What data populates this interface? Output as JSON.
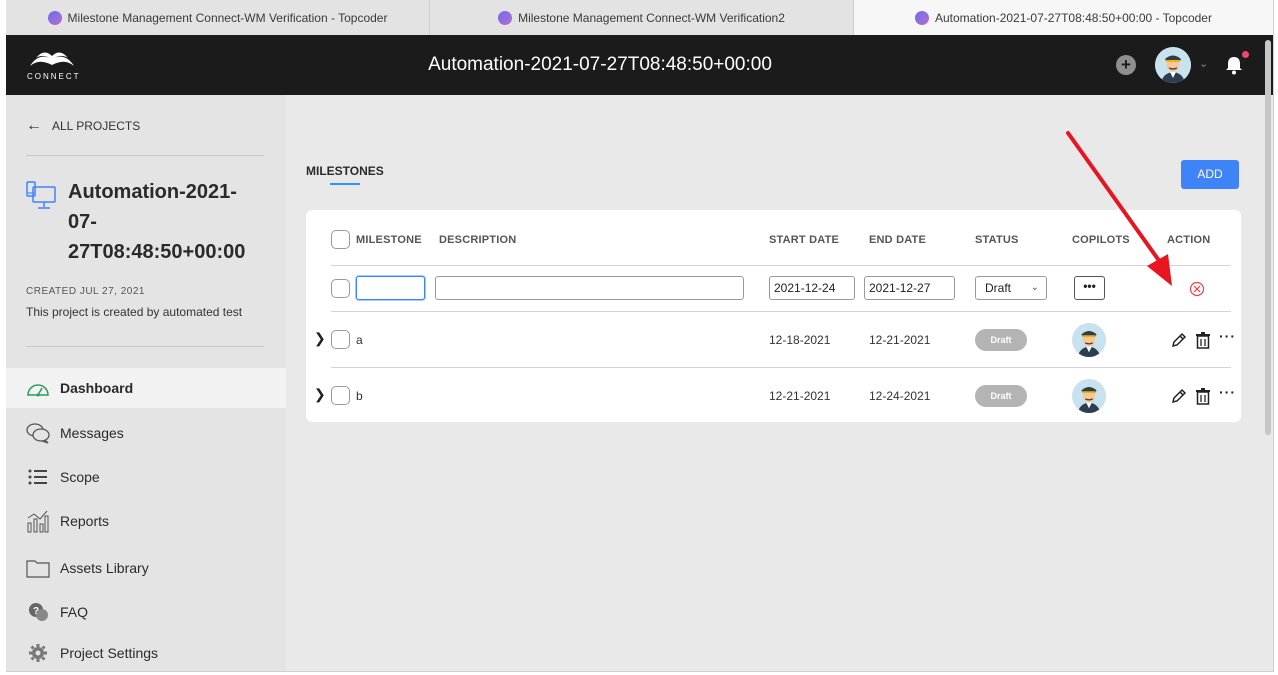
{
  "browser_tabs": [
    {
      "title": "Milestone Management Connect-WM Verification - Topcoder",
      "active": false
    },
    {
      "title": "Milestone Management Connect-WM Verification2",
      "active": false
    },
    {
      "title": "Automation-2021-07-27T08:48:50+00:00 - Topcoder",
      "active": true
    }
  ],
  "header": {
    "logo_text": "CONNECT",
    "project_title": "Automation-2021-07-27T08:48:50+00:00"
  },
  "sidebar": {
    "back_label": "ALL PROJECTS",
    "project_title_lines": [
      "Automation-2021-",
      "07-",
      "27T08:48:50+00:00"
    ],
    "created": "CREATED JUL 27, 2021",
    "description": "This project is created by automated test",
    "nav": [
      {
        "label": "Dashboard",
        "icon": "gauge-icon",
        "active": true
      },
      {
        "label": "Messages",
        "icon": "chat-bubbles-icon",
        "active": false
      },
      {
        "label": "Scope",
        "icon": "list-icon",
        "active": false
      },
      {
        "label": "Reports",
        "icon": "chart-icon",
        "active": false
      },
      {
        "label": "Assets Library",
        "icon": "folder-icon",
        "active": false
      },
      {
        "label": "FAQ",
        "icon": "question-bubble-icon",
        "active": false
      },
      {
        "label": "Project Settings",
        "icon": "gear-icon",
        "active": false
      }
    ]
  },
  "main": {
    "section_title": "MILESTONES",
    "add_label": "ADD",
    "columns": [
      "MILESTONE",
      "DESCRIPTION",
      "START DATE",
      "END DATE",
      "STATUS",
      "COPILOTS",
      "ACTION"
    ],
    "new_row": {
      "milestone_value": "",
      "description_value": "",
      "start_date": "2021-12-24",
      "end_date": "2021-12-27",
      "status": "Draft",
      "copilot_button": "•••"
    },
    "rows": [
      {
        "milestone": "a",
        "start": "12-18-2021",
        "end": "12-21-2021",
        "status": "Draft"
      },
      {
        "milestone": "b",
        "start": "12-21-2021",
        "end": "12-24-2021",
        "status": "Draft"
      }
    ]
  },
  "colors": {
    "accent": "#3f84f7",
    "annotation_arrow": "#e8141f",
    "cancel_icon": "#e8414c",
    "header_bg": "#1b1b1b"
  }
}
